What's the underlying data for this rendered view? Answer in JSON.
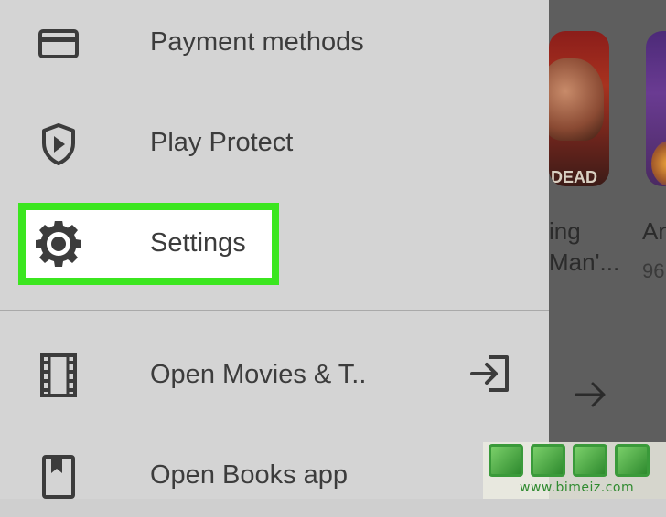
{
  "drawer": {
    "items": [
      {
        "label": "Payment methods",
        "icon": "credit-card-icon"
      },
      {
        "label": "Play Protect",
        "icon": "shield-play-icon"
      },
      {
        "label": "Settings",
        "icon": "gear-icon",
        "highlighted": true
      },
      {
        "label": "Open Movies & T..",
        "icon": "film-icon",
        "trailing_icon": "open-external-icon"
      },
      {
        "label": "Open Books app",
        "icon": "bookmark-book-icon"
      }
    ]
  },
  "background": {
    "apps": [
      {
        "title_line1": "ing",
        "title_line2": "Man'...",
        "thumbnail_text": "DEAD"
      },
      {
        "title_line1": "An",
        "rating": "96"
      }
    ]
  },
  "watermark": {
    "glyphs": "生活百科",
    "url": "www.bimeiz.com"
  },
  "colors": {
    "drawer_bg": "#d4d4d4",
    "highlight": "#3be61f",
    "icon": "#3c3c3c",
    "overlay": "#5e5e5e"
  }
}
